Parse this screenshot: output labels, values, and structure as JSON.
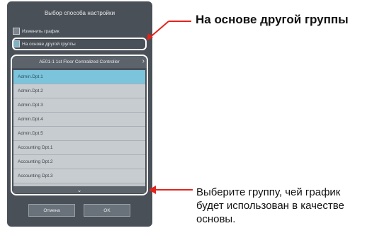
{
  "dialog": {
    "title": "Выбор способа настройки",
    "options": [
      {
        "label": "Изменить график",
        "checked": false
      },
      {
        "label": "На основе другой группы",
        "checked": true
      }
    ],
    "controller": "AE01-1 1st Floor Centralized Controller",
    "groups": [
      {
        "label": "Admin.Dpt.1",
        "selected": true
      },
      {
        "label": "Admin.Dpt.2",
        "selected": false
      },
      {
        "label": "Admin.Dpt.3",
        "selected": false
      },
      {
        "label": "Admin.Dpt.4",
        "selected": false
      },
      {
        "label": "Admin.Dpt.5",
        "selected": false
      },
      {
        "label": "Accounting Dpt.1",
        "selected": false
      },
      {
        "label": "Accounting Dpt.2",
        "selected": false
      },
      {
        "label": "Accounting Dpt.3",
        "selected": false
      }
    ],
    "cancel_label": "Отмена",
    "ok_label": "OK"
  },
  "annotations": {
    "based_on_other_group": "На основе другой группы",
    "select_group": "Выберите группу, чей график будет использован в качестве основы."
  },
  "colors": {
    "panel": "#4a5058",
    "selected_row": "#7cc4db",
    "arrow": "#e3231b"
  }
}
